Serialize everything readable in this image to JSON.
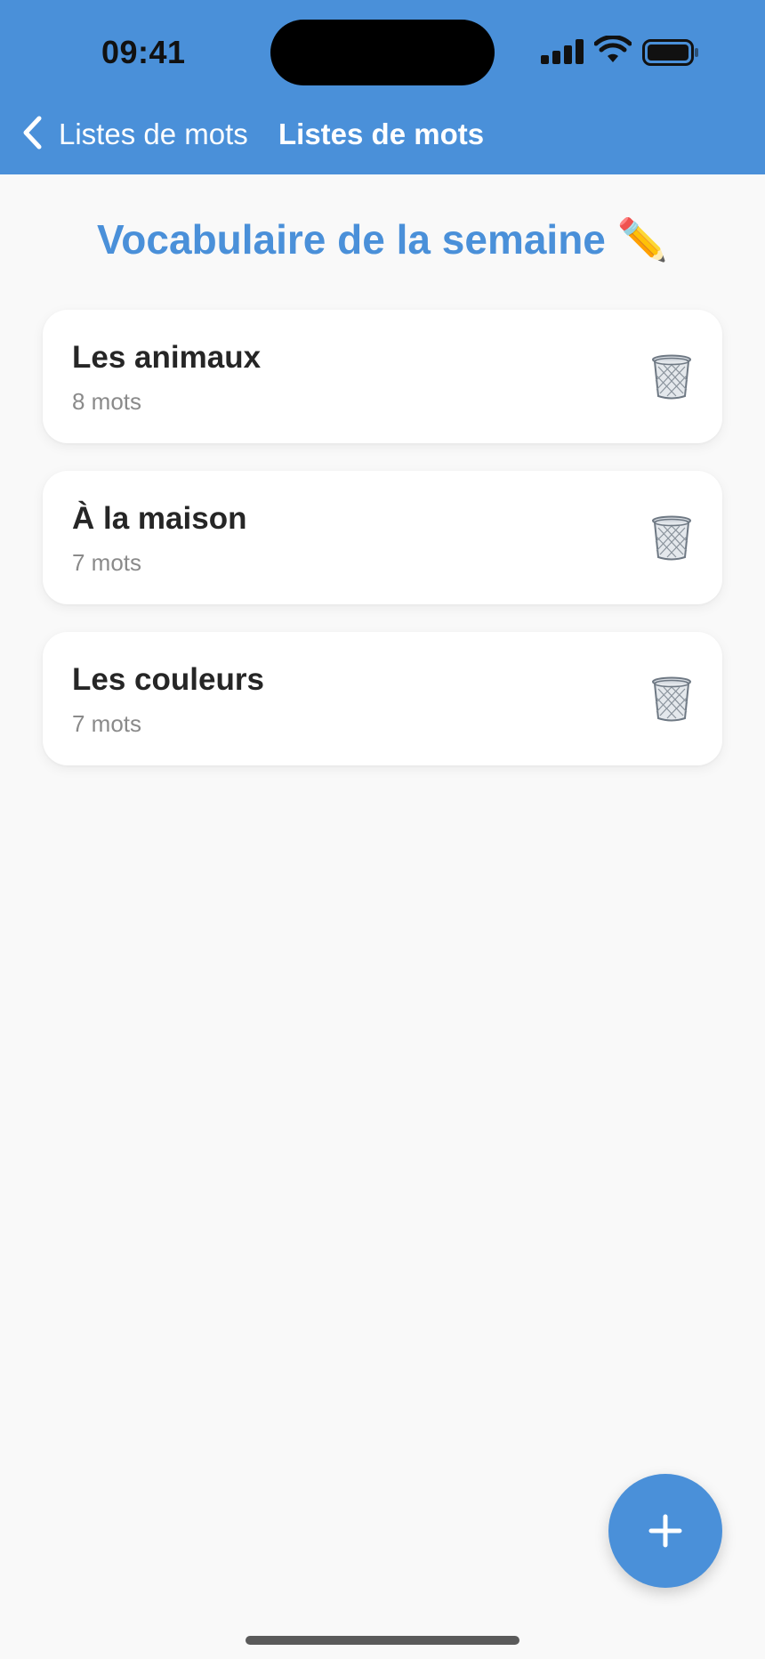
{
  "status_bar": {
    "time": "09:41"
  },
  "nav": {
    "back_label": "Listes de mots",
    "title": "Listes de mots"
  },
  "page": {
    "heading": "Vocabulaire de la semaine ✏️"
  },
  "lists": [
    {
      "title": "Les animaux",
      "count": "8 mots"
    },
    {
      "title": "À la maison",
      "count": "7 mots"
    },
    {
      "title": "Les couleurs",
      "count": "7 mots"
    }
  ],
  "icons": {
    "back": "chevron-left-icon",
    "delete": "trash-icon",
    "add": "plus-icon"
  },
  "colors": {
    "accent": "#4a90d9",
    "background": "#f9f9f9",
    "card": "#ffffff",
    "title_text": "#262626",
    "secondary_text": "#8a8a8a"
  }
}
